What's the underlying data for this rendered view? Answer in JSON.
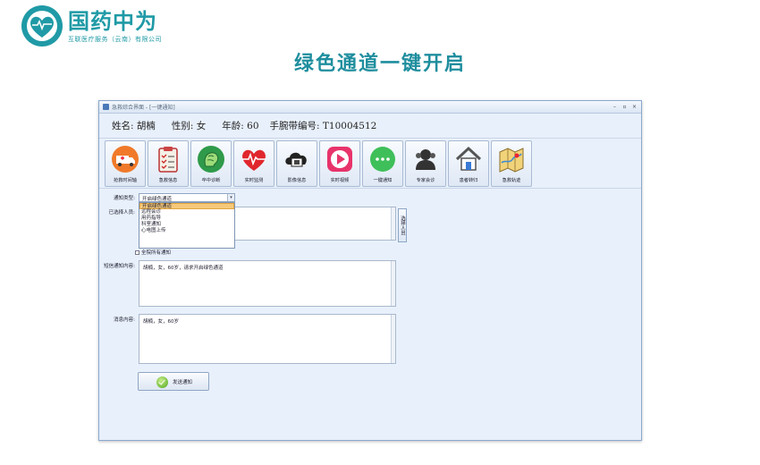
{
  "logo": {
    "name": "国药中为",
    "sub": "互联医疗服务（云南）有限公司"
  },
  "slide_title": "绿色通道一键开启",
  "window": {
    "title": "急救综合界面 - [一键通知]",
    "controls": [
      "–",
      "▫",
      "×"
    ]
  },
  "patient": {
    "name": "姓名: 胡楠",
    "gender": "性别: 女",
    "age": "年龄: 60",
    "band": "手腕带编号: T10004512"
  },
  "toolbar": [
    {
      "label": "抢救时间轴",
      "icon": "ambulance-icon"
    },
    {
      "label": "急救信息",
      "icon": "clipboard-icon"
    },
    {
      "label": "卒中诊断",
      "icon": "brain-icon"
    },
    {
      "label": "实时监测",
      "icon": "heart-monitor-icon"
    },
    {
      "label": "影像信息",
      "icon": "film-cloud-icon"
    },
    {
      "label": "实时视频",
      "icon": "video-play-icon"
    },
    {
      "label": "一键通知",
      "icon": "chat-bubble-icon"
    },
    {
      "label": "专家会诊",
      "icon": "expert-icon"
    },
    {
      "label": "患者转归",
      "icon": "home-icon"
    },
    {
      "label": "急救轨迹",
      "icon": "map-icon"
    }
  ],
  "form": {
    "notify_type_label": "通知类型:",
    "notify_type_value": "开启绿色通道",
    "options": [
      "开启绿色通道",
      "远程会诊",
      "用药指导",
      "科室通知",
      "心电图上传"
    ],
    "selected_people_label": "已选择人员:",
    "choose_button": "选择人员",
    "checkbox_label": "全院所有通知",
    "sms_label": "短信通知内容:",
    "sms_value": "胡楠，女，60岁，请求开启绿色通道",
    "msg_label": "消息内容:",
    "msg_value": "胡楠，女，60岁",
    "send_button": "发送通知"
  }
}
